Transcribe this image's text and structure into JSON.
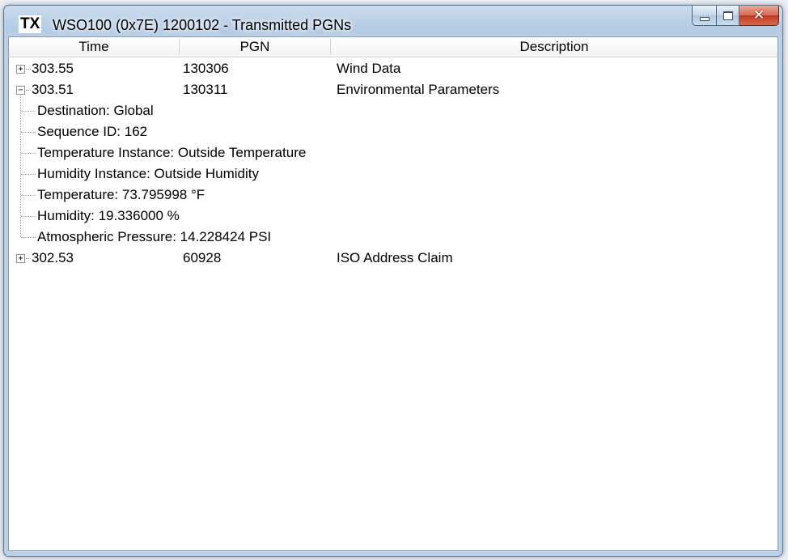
{
  "window": {
    "app_icon_text": "TX",
    "title": "WSO100 (0x7E) 1200102 - Transmitted PGNs"
  },
  "columns": {
    "time": "Time",
    "pgn": "PGN",
    "description": "Description"
  },
  "rows": [
    {
      "expander": "+",
      "time": "303.55",
      "pgn": "130306",
      "description": "Wind Data"
    },
    {
      "expander": "−",
      "time": "303.51",
      "pgn": "130311",
      "description": "Environmental Parameters",
      "children": [
        "Destination: Global",
        "Sequence ID: 162",
        "Temperature Instance: Outside Temperature",
        "Humidity Instance: Outside Humidity",
        "Temperature: 73.795998 °F",
        "Humidity: 19.336000 %",
        "Atmospheric Pressure: 14.228424 PSI"
      ]
    },
    {
      "expander": "+",
      "time": "302.53",
      "pgn": "60928",
      "description": "ISO Address Claim"
    }
  ]
}
